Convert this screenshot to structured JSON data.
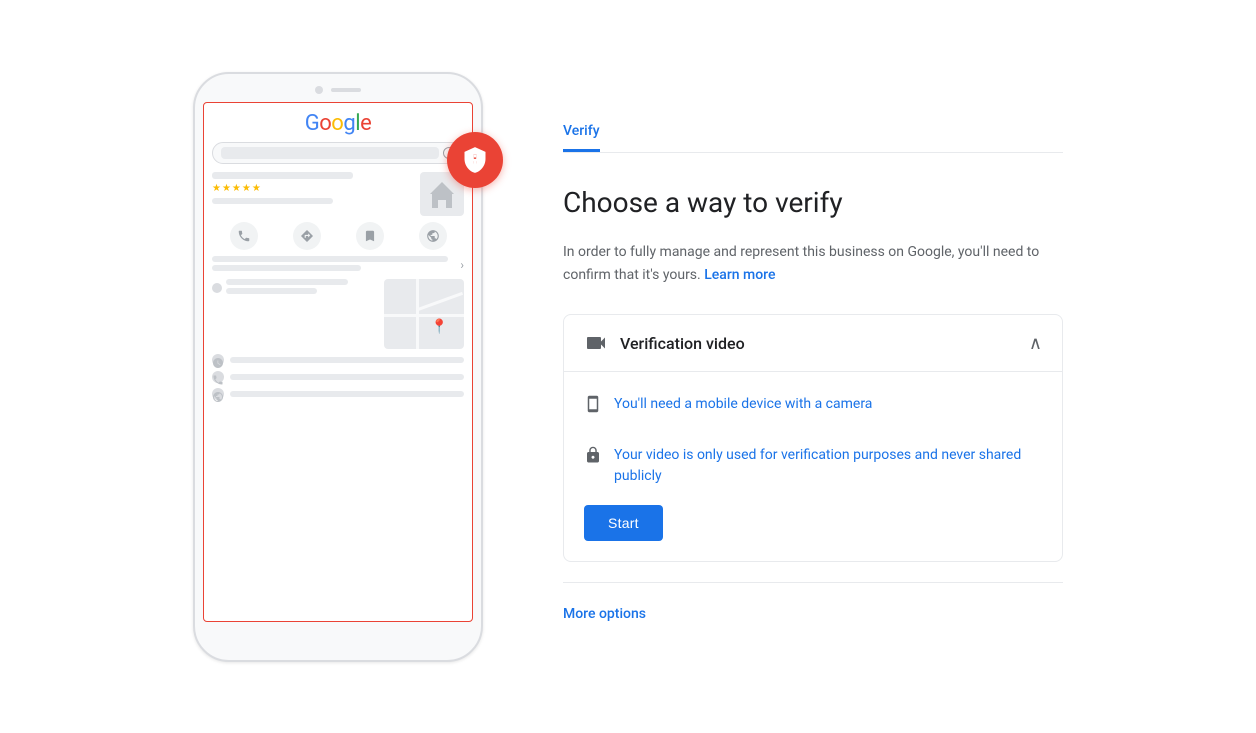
{
  "tab": {
    "label": "Verify"
  },
  "page": {
    "title": "Choose a way to verify",
    "description_part1": "In order to fully manage and represent this business on Google, you'll need to confirm that it's yours.",
    "learn_more_label": "Learn more"
  },
  "verification_option": {
    "title": "Verification video",
    "details": [
      {
        "id": "mobile",
        "text": "You'll need a mobile device with a camera"
      },
      {
        "id": "privacy",
        "text": "Your video is only used for verification purposes and never shared publicly"
      }
    ]
  },
  "buttons": {
    "start_label": "Start",
    "more_options_label": "More options"
  },
  "phone_mockup": {
    "google_logo_letters": [
      "G",
      "o",
      "o",
      "g",
      "l",
      "e"
    ],
    "stars": "★★★★★"
  },
  "shield_icon": "shield-exclamation",
  "colors": {
    "google_blue": "#4285f4",
    "google_red": "#ea4335",
    "google_yellow": "#fbbc05",
    "google_green": "#34a853",
    "primary_blue": "#1a73e8",
    "text_dark": "#202124",
    "text_medium": "#5f6368",
    "border": "#e8eaed"
  }
}
